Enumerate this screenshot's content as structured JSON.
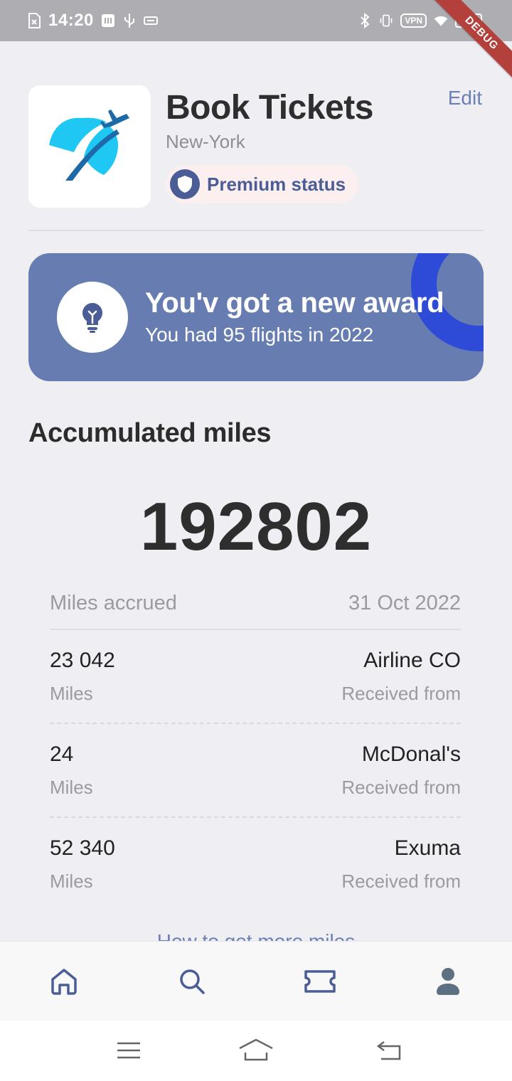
{
  "status_bar": {
    "time": "14:20",
    "vpn": "VPN",
    "battery": "100"
  },
  "debug_ribbon": "DEBUG",
  "profile": {
    "name": "Book Tickets",
    "city": "New-York",
    "status": "Premium status",
    "edit": "Edit"
  },
  "award": {
    "title": "You'v got a new award",
    "subtitle": "You had 95 flights in 2022"
  },
  "miles": {
    "section_title": "Accumulated miles",
    "total": "192802",
    "header_label": "Miles accrued",
    "header_date": "31 Oct 2022",
    "rows": [
      {
        "amount": "23 042",
        "unit": "Miles",
        "source": "Airline CO",
        "caption": "Received from"
      },
      {
        "amount": "24",
        "unit": "Miles",
        "source": "McDonal's",
        "caption": "Received from"
      },
      {
        "amount": "52 340",
        "unit": "Miles",
        "source": "Exuma",
        "caption": "Received from"
      }
    ],
    "more_link": "How to get more miles"
  },
  "colors": {
    "accent": "#4b5d96",
    "award_card": "#677db1",
    "award_ring": "#2d4bd6",
    "link": "#6b7fb3",
    "logo_cyan": "#1ec8f3",
    "logo_blue": "#1e6aa8"
  },
  "icons": {
    "nav": [
      "home-icon",
      "search-icon",
      "ticket-icon",
      "profile-icon"
    ],
    "system": [
      "menu-icon",
      "home-system-icon",
      "back-icon"
    ]
  }
}
